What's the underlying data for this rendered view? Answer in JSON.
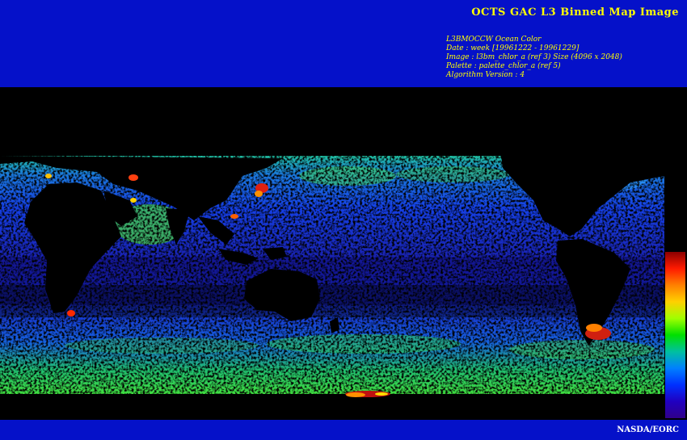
{
  "header": {
    "title": "OCTS GAC L3 Binned Map Image",
    "meta_lines": [
      "L3BMOCCW Ocean Color",
      "Date : week [19961222 - 19961229]",
      "Image : l3bm_chlor_a (ref 3) Size (4096 x 2048)",
      "Palette : palette_chlor_a (ref 5)",
      "Algorithm Version : 4"
    ]
  },
  "map": {
    "projection": "equirectangular",
    "background_color": "#000000",
    "colorbar_colors": [
      "#8b0000",
      "#ff1a00",
      "#ff8000",
      "#ffd000",
      "#a0ff00",
      "#00e000",
      "#00c0a0",
      "#0080ff",
      "#0030ff",
      "#2000c0",
      "#30008a"
    ]
  },
  "footer": {
    "credit": "NASDA/EORC"
  },
  "colors": {
    "banner": "#0511c9",
    "title_text": "#ffff00",
    "credit_text": "#ffffff"
  }
}
